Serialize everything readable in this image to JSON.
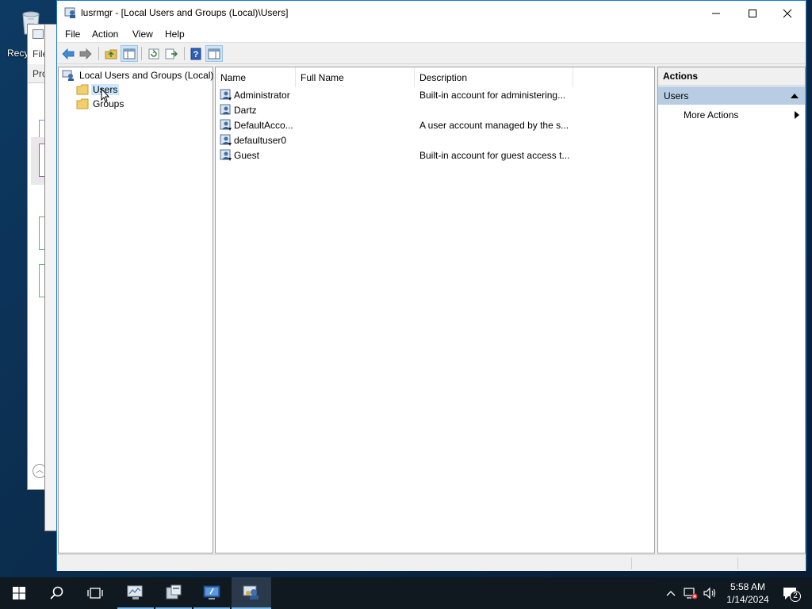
{
  "desktop": {
    "recycle_bin_label": "Recy",
    "bg_window": {
      "menu": "File",
      "tab": "Pro"
    }
  },
  "window": {
    "title": "lusrmgr - [Local Users and Groups (Local)\\Users]",
    "minimize_icon": "minimize-icon",
    "maximize_icon": "maximize-icon",
    "close_icon": "close-icon"
  },
  "menu": {
    "file": "File",
    "action": "Action",
    "view": "View",
    "help": "Help"
  },
  "toolbar": {
    "buttons": [
      "back-arrow-icon",
      "forward-arrow-icon",
      "up-folder-icon",
      "show-hide-tree-icon",
      "refresh-icon",
      "export-list-icon",
      "help-icon",
      "show-hide-action-pane-icon"
    ]
  },
  "tree": {
    "root": "Local Users and Groups (Local)",
    "items": [
      {
        "label": "Users",
        "selected": true
      },
      {
        "label": "Groups",
        "selected": false
      }
    ]
  },
  "list": {
    "columns": [
      "Name",
      "Full Name",
      "Description"
    ],
    "rows": [
      {
        "name": "Administrator",
        "full_name": "",
        "description": "Built-in account for administering..."
      },
      {
        "name": "Dartz",
        "full_name": "",
        "description": ""
      },
      {
        "name": "DefaultAcco...",
        "full_name": "",
        "description": "A user account managed by the s..."
      },
      {
        "name": "defaultuser0",
        "full_name": "",
        "description": ""
      },
      {
        "name": "Guest",
        "full_name": "",
        "description": "Built-in account for guest access t..."
      }
    ]
  },
  "actions": {
    "header": "Actions",
    "group": "Users",
    "more": "More Actions"
  },
  "taskbar": {
    "time": "5:58 AM",
    "date": "1/14/2024",
    "notification_count": "2"
  },
  "colors": {
    "selection": "#cce8ff",
    "action_group": "#b8cde3",
    "title_border": "#1979ca",
    "taskbar": "#101820"
  }
}
